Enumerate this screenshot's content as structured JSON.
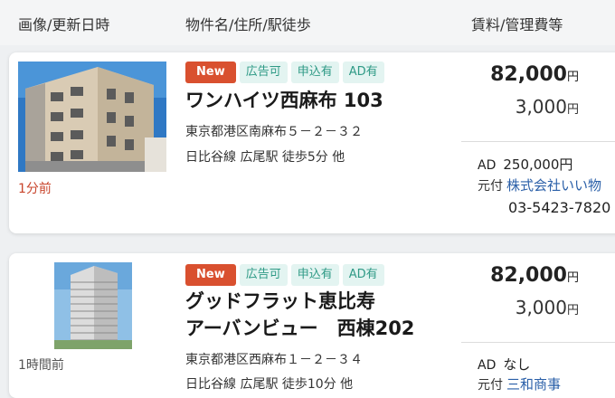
{
  "header": {
    "col_image": "画像/更新日時",
    "col_name": "物件名/住所/駅徒歩",
    "col_rent": "賃料/管理費等"
  },
  "listings": [
    {
      "time": "1分前",
      "tags": [
        "New",
        "広告可",
        "申込有",
        "AD有"
      ],
      "name_lines": [
        "ワンハイツ西麻布 103"
      ],
      "address": "東京都港区南麻布５－２－３２",
      "station": "日比谷線 広尾駅 徒歩5分 他",
      "rent": "82,000",
      "fee": "3,000",
      "yen": "円",
      "ad_label": "AD",
      "ad_value": "250,000円",
      "agent_label": "元付",
      "agent_name": "株式会社いい物",
      "phone": "03-5423-7820"
    },
    {
      "time": "1時間前",
      "tags": [
        "New",
        "広告可",
        "申込有",
        "AD有"
      ],
      "name_lines": [
        "グッドフラット恵比寿",
        "アーバンビュー　西棟202"
      ],
      "address": "東京都港区西麻布１－２－３４",
      "station": "日比谷線 広尾駅 徒歩10分 他",
      "rent": "82,000",
      "fee": "3,000",
      "yen": "円",
      "ad_label": "AD",
      "ad_value": "なし",
      "agent_label": "元付",
      "agent_name": "三和商事"
    }
  ]
}
